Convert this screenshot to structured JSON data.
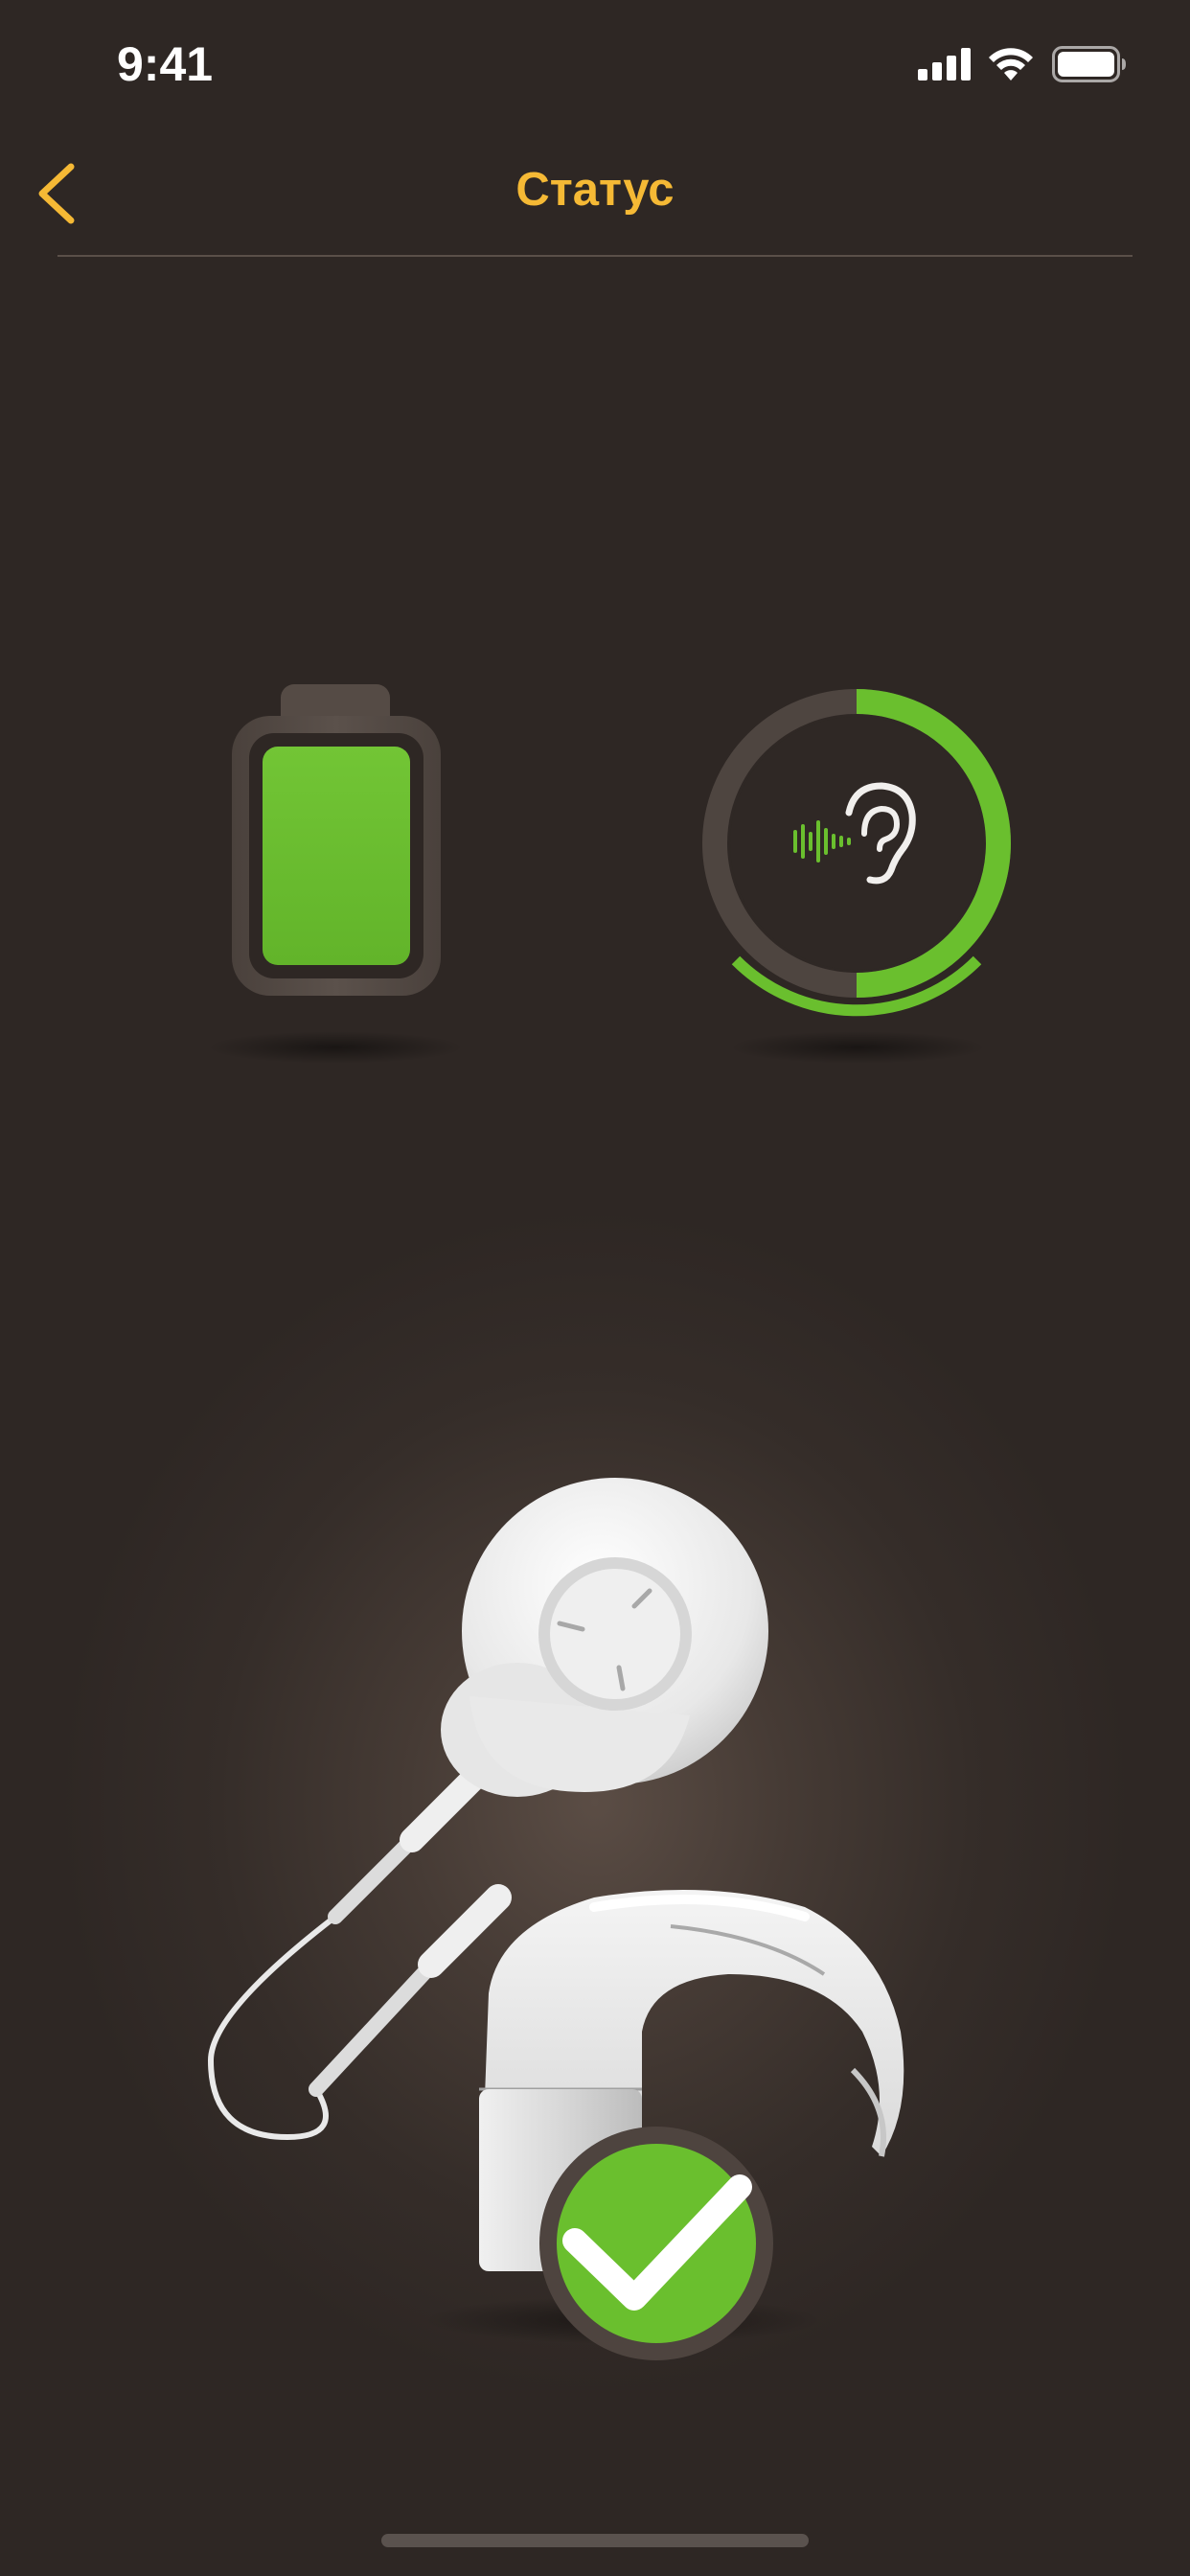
{
  "status_bar": {
    "time": "9:41",
    "icons": [
      "cellular-signal-icon",
      "wifi-icon",
      "battery-icon"
    ]
  },
  "nav": {
    "back_icon": "chevron-left-icon",
    "title": "Статус"
  },
  "status_tiles": {
    "battery": {
      "icon": "battery-full-icon",
      "level_fraction": 1.0,
      "fill_color": "#6abf2e"
    },
    "hearing": {
      "icon": "ear-soundwave-icon",
      "ring_fill_fraction": 0.5,
      "ring_color": "#6abf2e"
    }
  },
  "device": {
    "icon": "sound-processor-device-icon",
    "status_icon": "checkmark-icon",
    "status_color": "#6abf2e"
  },
  "colors": {
    "accent": "#f5b935",
    "ok_green": "#6abf2e",
    "background": "#2d2623"
  }
}
